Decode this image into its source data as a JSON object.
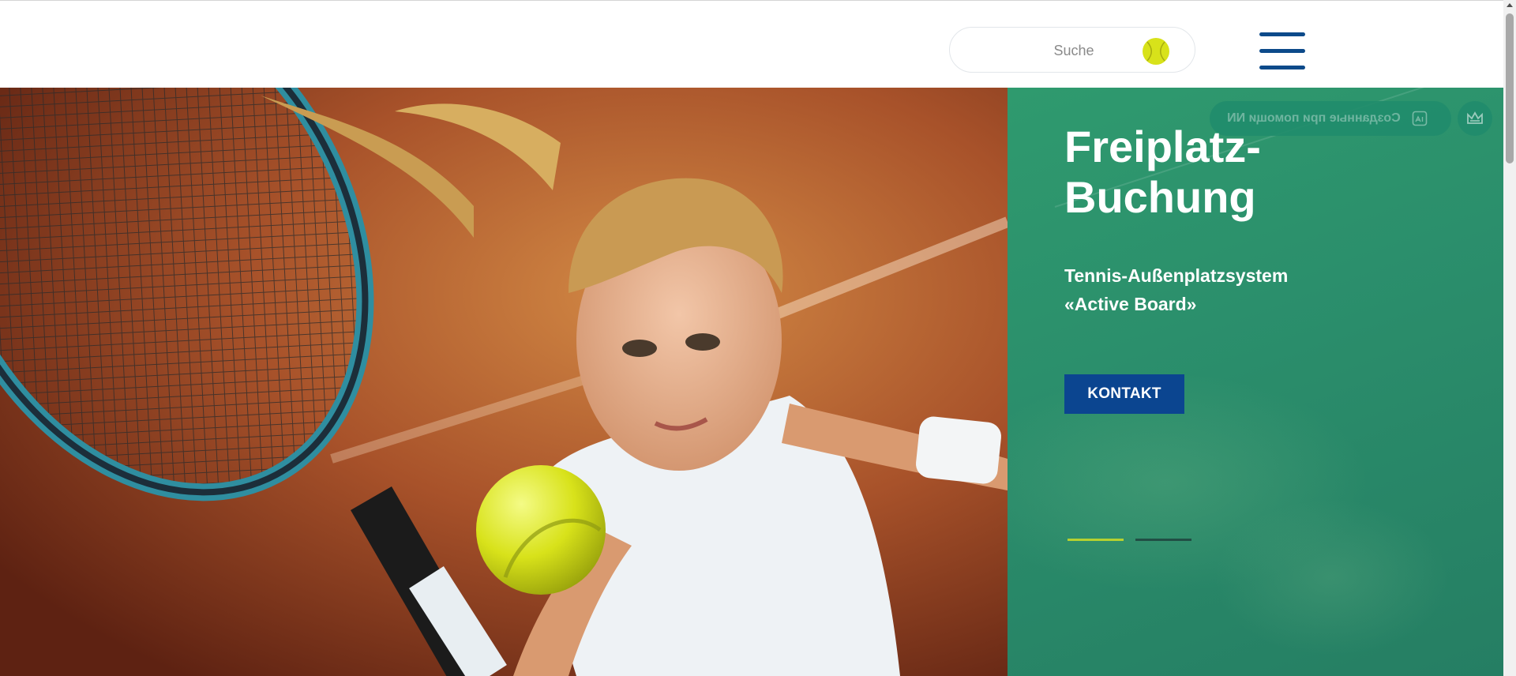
{
  "search": {
    "placeholder": "Suche"
  },
  "icons": {
    "search_ball": "tennis-ball-icon",
    "menu": "hamburger-menu-icon",
    "badge_image": "image-ai-icon",
    "crown": "crown-icon"
  },
  "badge": {
    "text": "Созданные при помощи NN"
  },
  "hero": {
    "title_line1": "Freiplatz-",
    "title_line2": "Buchung",
    "subtitle_line1": "Tennis-Außenplatzsystem",
    "subtitle_line2": "«Active Board»",
    "cta_label": "KONTAKT",
    "slides_total": 2,
    "active_slide": 1
  },
  "colors": {
    "accent_blue": "#0b4590",
    "panel_green": "#2b8f6c",
    "ball_yellow": "#d8e21a",
    "indicator_active": "#b6d130"
  }
}
